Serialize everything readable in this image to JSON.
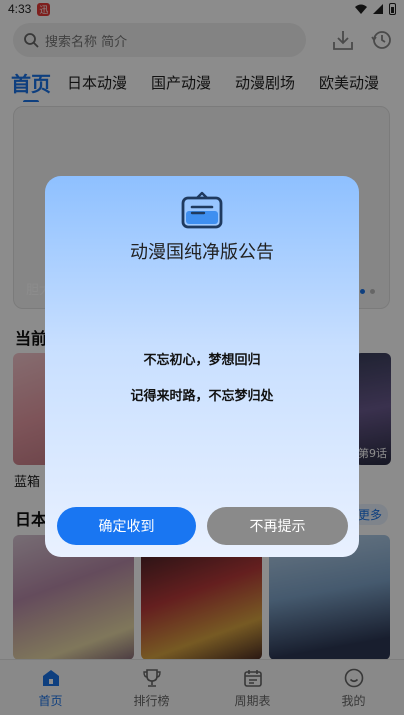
{
  "status_bar": {
    "time": "4:33",
    "app_badge": "迅"
  },
  "search": {
    "placeholder": "搜索名称 简介"
  },
  "tabs": [
    "首页",
    "日本动漫",
    "国产动漫",
    "动漫剧场",
    "欧美动漫"
  ],
  "banner": {
    "caption": "胆大"
  },
  "sections": {
    "current": {
      "title": "当前"
    },
    "japan": {
      "title": "日本",
      "more": "更多"
    }
  },
  "cards": {
    "current_first_title": "蓝箱",
    "current_last_badge": "第9话"
  },
  "bottom_nav": [
    {
      "label": "首页",
      "icon": "home-icon"
    },
    {
      "label": "排行榜",
      "icon": "trophy-icon"
    },
    {
      "label": "周期表",
      "icon": "calendar-icon"
    },
    {
      "label": "我的",
      "icon": "smile-icon"
    }
  ],
  "dialog": {
    "icon": "notice-board-icon",
    "title": "动漫国纯净版公告",
    "lines": [
      "不忘初心，梦想回归",
      "记得来时路，不忘梦归处"
    ],
    "confirm_label": "确定收到",
    "dismiss_label": "不再提示"
  },
  "colors": {
    "accent": "#1a73e8",
    "confirm": "#1976f2",
    "dismiss": "#8a8a8a"
  }
}
